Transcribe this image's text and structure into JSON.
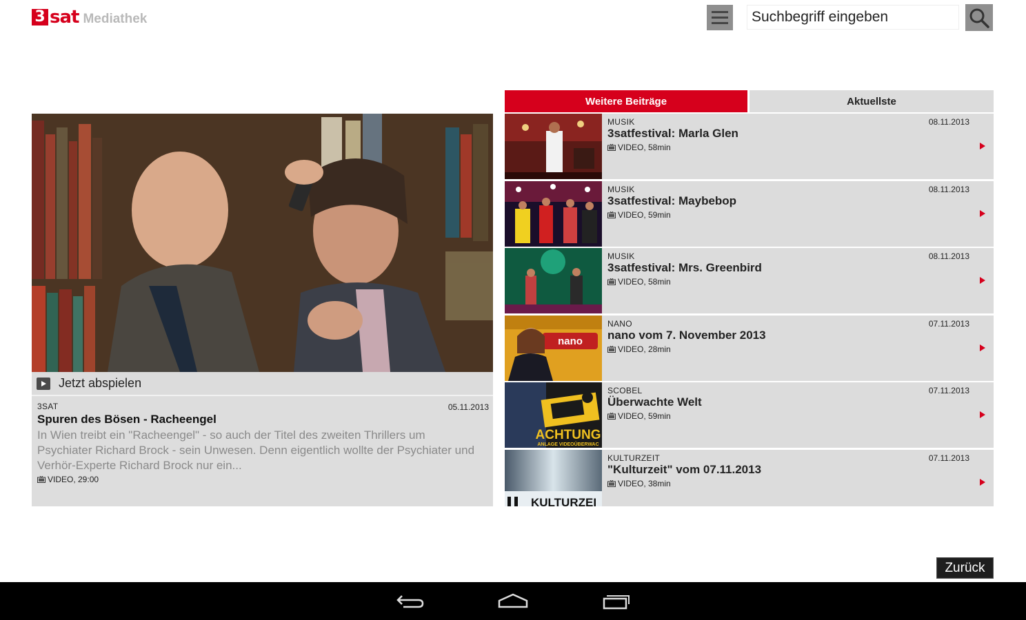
{
  "header": {
    "logo_badge": "3",
    "logo_sat": "sat",
    "logo_mediathek": "Mediathek",
    "search_placeholder": "Suchbegriff eingeben"
  },
  "featured": {
    "play_label": "Jetzt abspielen",
    "category": "3SAT",
    "date": "05.11.2013",
    "title": "Spuren des Bösen - Racheengel",
    "description": "In Wien treibt ein \"Racheengel\" - so auch der Titel des zweiten Thrillers um Psychiater Richard Brock - sein Unwesen. Denn eigentlich wollte der Psychiater und Verhör-Experte Richard Brock nur ein...",
    "meta": "VIDEO, 29:00"
  },
  "tabs": {
    "active": "Weitere Beiträge",
    "inactive": "Aktuellste"
  },
  "items": [
    {
      "category": "MUSIK",
      "date": "08.11.2013",
      "title": "3satfestival: Marla Glen",
      "meta": "VIDEO, 58min"
    },
    {
      "category": "MUSIK",
      "date": "08.11.2013",
      "title": "3satfestival: Maybebop",
      "meta": "VIDEO, 59min"
    },
    {
      "category": "MUSIK",
      "date": "08.11.2013",
      "title": "3satfestival: Mrs. Greenbird",
      "meta": "VIDEO, 58min"
    },
    {
      "category": "NANO",
      "date": "07.11.2013",
      "title": "nano vom 7. November 2013",
      "meta": "VIDEO, 28min"
    },
    {
      "category": "SCOBEL",
      "date": "07.11.2013",
      "title": "Überwachte Welt",
      "meta": "VIDEO, 59min"
    },
    {
      "category": "KULTURZEIT",
      "date": "07.11.2013",
      "title": "\"Kulturzeit\" vom 07.11.2013",
      "meta": "VIDEO, 38min"
    }
  ],
  "thumb_text": {
    "nano": "nano",
    "achtung": "ACHTUNG",
    "achtung_sub": "ANLAGE VIDEOÜBERWAC",
    "kulturzeit": "KULTURZEI"
  },
  "back_label": "Zurück",
  "colors": {
    "brand_red": "#d6001c",
    "panel_gray": "#dcdcdc",
    "button_gray": "#8f8f8f"
  },
  "icons": {
    "menu": "hamburger-icon",
    "search": "search-icon",
    "play": "play-icon",
    "video": "tv-icon",
    "arrow": "arrow-right-icon",
    "nav_back": "back-icon",
    "nav_home": "home-icon",
    "nav_recents": "recents-icon"
  }
}
